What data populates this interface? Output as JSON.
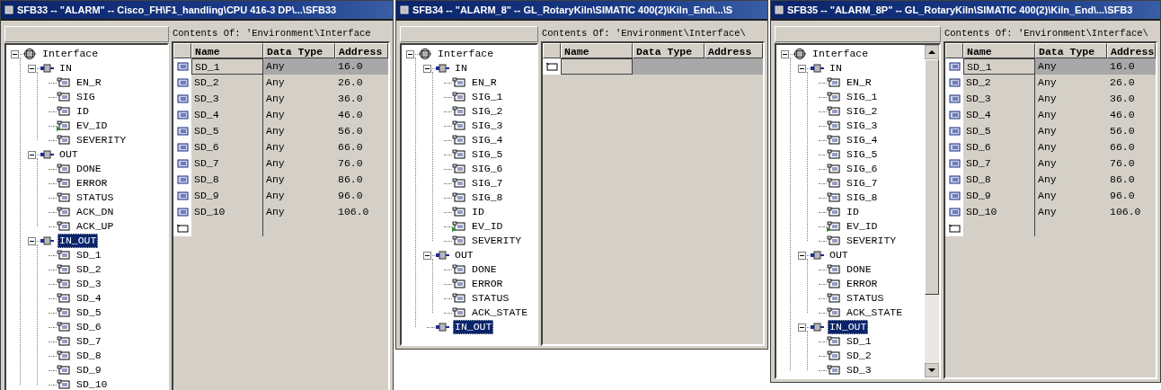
{
  "windows": [
    {
      "title": "SFB33 -- \"ALARM\" -- Cisco_FH\\F1_handling\\CPU 416-3 DP\\...\\SFB33",
      "tree": [
        {
          "label": "Interface",
          "kind": "root",
          "expanded": true,
          "selected": false,
          "children": [
            {
              "label": "IN",
              "kind": "section",
              "expanded": true,
              "selected": false,
              "children": [
                {
                  "label": "EN_R",
                  "kind": "param",
                  "selected": false
                },
                {
                  "label": "SIG",
                  "kind": "param",
                  "selected": false
                },
                {
                  "label": "ID",
                  "kind": "param",
                  "selected": false
                },
                {
                  "label": "EV_ID",
                  "kind": "flagged",
                  "selected": false
                },
                {
                  "label": "SEVERITY",
                  "kind": "param",
                  "selected": false
                }
              ]
            },
            {
              "label": "OUT",
              "kind": "section",
              "expanded": true,
              "selected": false,
              "children": [
                {
                  "label": "DONE",
                  "kind": "param",
                  "selected": false
                },
                {
                  "label": "ERROR",
                  "kind": "param",
                  "selected": false
                },
                {
                  "label": "STATUS",
                  "kind": "param",
                  "selected": false
                },
                {
                  "label": "ACK_DN",
                  "kind": "param",
                  "selected": false
                },
                {
                  "label": "ACK_UP",
                  "kind": "param",
                  "selected": false
                }
              ]
            },
            {
              "label": "IN_OUT",
              "kind": "section",
              "expanded": true,
              "selected": true,
              "children": [
                {
                  "label": "SD_1",
                  "kind": "param",
                  "selected": false
                },
                {
                  "label": "SD_2",
                  "kind": "param",
                  "selected": false
                },
                {
                  "label": "SD_3",
                  "kind": "param",
                  "selected": false
                },
                {
                  "label": "SD_4",
                  "kind": "param",
                  "selected": false
                },
                {
                  "label": "SD_5",
                  "kind": "param",
                  "selected": false
                },
                {
                  "label": "SD_6",
                  "kind": "param",
                  "selected": false
                },
                {
                  "label": "SD_7",
                  "kind": "param",
                  "selected": false
                },
                {
                  "label": "SD_8",
                  "kind": "param",
                  "selected": false
                },
                {
                  "label": "SD_9",
                  "kind": "param",
                  "selected": false
                },
                {
                  "label": "SD_10",
                  "kind": "param",
                  "selected": false
                }
              ]
            }
          ]
        }
      ],
      "contents_label": "Contents Of: 'Environment\\Interface",
      "table": {
        "columns": [
          "Name",
          "Data Type",
          "Address"
        ],
        "rows": [
          {
            "name": "SD_1",
            "data_type": "Any",
            "address": "16.0",
            "selected": true
          },
          {
            "name": "SD_2",
            "data_type": "Any",
            "address": "26.0",
            "selected": false
          },
          {
            "name": "SD_3",
            "data_type": "Any",
            "address": "36.0",
            "selected": false
          },
          {
            "name": "SD_4",
            "data_type": "Any",
            "address": "46.0",
            "selected": false
          },
          {
            "name": "SD_5",
            "data_type": "Any",
            "address": "56.0",
            "selected": false
          },
          {
            "name": "SD_6",
            "data_type": "Any",
            "address": "66.0",
            "selected": false
          },
          {
            "name": "SD_7",
            "data_type": "Any",
            "address": "76.0",
            "selected": false
          },
          {
            "name": "SD_8",
            "data_type": "Any",
            "address": "86.0",
            "selected": false
          },
          {
            "name": "SD_9",
            "data_type": "Any",
            "address": "96.0",
            "selected": false
          },
          {
            "name": "SD_10",
            "data_type": "Any",
            "address": "106.0",
            "selected": false
          }
        ]
      }
    },
    {
      "title": "SFB34 -- \"ALARM_8\" -- GL_RotaryKiln\\SIMATIC 400(2)\\Kiln_End\\...\\S",
      "tree": [
        {
          "label": "Interface",
          "kind": "root",
          "expanded": true,
          "selected": false,
          "children": [
            {
              "label": "IN",
              "kind": "section",
              "expanded": true,
              "selected": false,
              "children": [
                {
                  "label": "EN_R",
                  "kind": "param",
                  "selected": false
                },
                {
                  "label": "SIG_1",
                  "kind": "param",
                  "selected": false
                },
                {
                  "label": "SIG_2",
                  "kind": "param",
                  "selected": false
                },
                {
                  "label": "SIG_3",
                  "kind": "param",
                  "selected": false
                },
                {
                  "label": "SIG_4",
                  "kind": "param",
                  "selected": false
                },
                {
                  "label": "SIG_5",
                  "kind": "param",
                  "selected": false
                },
                {
                  "label": "SIG_6",
                  "kind": "param",
                  "selected": false
                },
                {
                  "label": "SIG_7",
                  "kind": "param",
                  "selected": false
                },
                {
                  "label": "SIG_8",
                  "kind": "param",
                  "selected": false
                },
                {
                  "label": "ID",
                  "kind": "param",
                  "selected": false
                },
                {
                  "label": "EV_ID",
                  "kind": "flagged",
                  "selected": false
                },
                {
                  "label": "SEVERITY",
                  "kind": "param",
                  "selected": false
                }
              ]
            },
            {
              "label": "OUT",
              "kind": "section",
              "expanded": true,
              "selected": false,
              "children": [
                {
                  "label": "DONE",
                  "kind": "param",
                  "selected": false
                },
                {
                  "label": "ERROR",
                  "kind": "param",
                  "selected": false
                },
                {
                  "label": "STATUS",
                  "kind": "param",
                  "selected": false
                },
                {
                  "label": "ACK_STATE",
                  "kind": "param",
                  "selected": false
                }
              ]
            },
            {
              "label": "IN_OUT",
              "kind": "section",
              "selected": true
            }
          ]
        }
      ],
      "contents_label": "Contents Of: 'Environment\\Interface\\",
      "table": {
        "columns": [
          "Name",
          "Data Type",
          "Address"
        ],
        "new_row": {
          "selected": true
        }
      }
    },
    {
      "title": "SFB35 -- \"ALARM_8P\" -- GL_RotaryKiln\\SIMATIC 400(2)\\Kiln_End\\...\\SFB3",
      "scrollbar": true,
      "tree": [
        {
          "label": "Interface",
          "kind": "root",
          "expanded": true,
          "selected": false,
          "children": [
            {
              "label": "IN",
              "kind": "section",
              "expanded": true,
              "selected": false,
              "children": [
                {
                  "label": "EN_R",
                  "kind": "param",
                  "selected": false
                },
                {
                  "label": "SIG_1",
                  "kind": "param",
                  "selected": false
                },
                {
                  "label": "SIG_2",
                  "kind": "param",
                  "selected": false
                },
                {
                  "label": "SIG_3",
                  "kind": "param",
                  "selected": false
                },
                {
                  "label": "SIG_4",
                  "kind": "param",
                  "selected": false
                },
                {
                  "label": "SIG_5",
                  "kind": "param",
                  "selected": false
                },
                {
                  "label": "SIG_6",
                  "kind": "param",
                  "selected": false
                },
                {
                  "label": "SIG_7",
                  "kind": "param",
                  "selected": false
                },
                {
                  "label": "SIG_8",
                  "kind": "param",
                  "selected": false
                },
                {
                  "label": "ID",
                  "kind": "param",
                  "selected": false
                },
                {
                  "label": "EV_ID",
                  "kind": "flagged",
                  "selected": false
                },
                {
                  "label": "SEVERITY",
                  "kind": "param",
                  "selected": false
                }
              ]
            },
            {
              "label": "OUT",
              "kind": "section",
              "expanded": true,
              "selected": false,
              "children": [
                {
                  "label": "DONE",
                  "kind": "param",
                  "selected": false
                },
                {
                  "label": "ERROR",
                  "kind": "param",
                  "selected": false
                },
                {
                  "label": "STATUS",
                  "kind": "param",
                  "selected": false
                },
                {
                  "label": "ACK_STATE",
                  "kind": "param",
                  "selected": false
                }
              ]
            },
            {
              "label": "IN_OUT",
              "kind": "section",
              "expanded": true,
              "selected": true,
              "children": [
                {
                  "label": "SD_1",
                  "kind": "param",
                  "selected": false
                },
                {
                  "label": "SD_2",
                  "kind": "param",
                  "selected": false
                },
                {
                  "label": "SD_3",
                  "kind": "param",
                  "selected": false
                }
              ]
            }
          ]
        }
      ],
      "contents_label": "Contents Of: 'Environment\\Interface\\",
      "table": {
        "columns": [
          "Name",
          "Data Type",
          "Address"
        ],
        "rows": [
          {
            "name": "SD_1",
            "data_type": "Any",
            "address": "16.0",
            "selected": true
          },
          {
            "name": "SD_2",
            "data_type": "Any",
            "address": "26.0",
            "selected": false
          },
          {
            "name": "SD_3",
            "data_type": "Any",
            "address": "36.0",
            "selected": false
          },
          {
            "name": "SD_4",
            "data_type": "Any",
            "address": "46.0",
            "selected": false
          },
          {
            "name": "SD_5",
            "data_type": "Any",
            "address": "56.0",
            "selected": false
          },
          {
            "name": "SD_6",
            "data_type": "Any",
            "address": "66.0",
            "selected": false
          },
          {
            "name": "SD_7",
            "data_type": "Any",
            "address": "76.0",
            "selected": false
          },
          {
            "name": "SD_8",
            "data_type": "Any",
            "address": "86.0",
            "selected": false
          },
          {
            "name": "SD_9",
            "data_type": "Any",
            "address": "96.0",
            "selected": false
          },
          {
            "name": "SD_10",
            "data_type": "Any",
            "address": "106.0",
            "selected": false
          }
        ]
      }
    }
  ]
}
